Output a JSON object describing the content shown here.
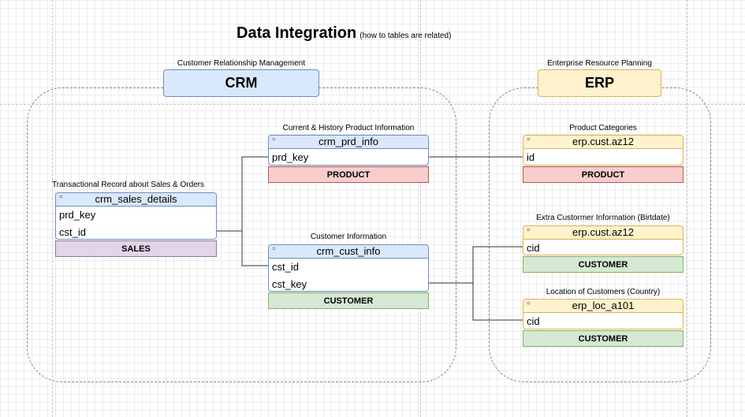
{
  "title": {
    "main": "Data Integration",
    "sub": "(how to tables are related)"
  },
  "crm": {
    "caption": "Customer Relationship Management",
    "label": "CRM"
  },
  "erp": {
    "caption": "Enterprise Resource Planning",
    "label": "ERP"
  },
  "sales_details": {
    "caption": "Transactional Record about Sales & Orders",
    "name": "crm_sales_details",
    "fields": [
      "prd_key",
      "cst_id"
    ],
    "tag": "SALES"
  },
  "prd_info": {
    "caption": "Current & History Product Information",
    "name": "crm_prd_info",
    "fields": [
      "prd_key"
    ],
    "tag": "PRODUCT"
  },
  "cust_info": {
    "caption": "Customer Information",
    "name": "crm_cust_info",
    "fields": [
      "cst_id",
      "cst_key"
    ],
    "tag": "CUSTOMER"
  },
  "erp_prod": {
    "caption": "Product Categories",
    "name": "erp.cust.az12",
    "fields": [
      "id"
    ],
    "tag": "PRODUCT"
  },
  "erp_cust": {
    "caption": "Extra Custormer Information (Birtdate)",
    "name": "erp.cust.az12",
    "fields": [
      "cid"
    ],
    "tag": "CUSTOMER"
  },
  "erp_loc": {
    "caption": "Location of Customers (Country)",
    "name": "erp_loc_a101",
    "fields": [
      "cid"
    ],
    "tag": "CUSTOMER"
  },
  "colors": {
    "blue_fill": "#dae8fc",
    "yellow_fill": "#fff2cc",
    "red_fill": "#f8cecc",
    "green_fill": "#d5e8d4",
    "purple_fill": "#e1d5e7",
    "connector": "#333333"
  }
}
